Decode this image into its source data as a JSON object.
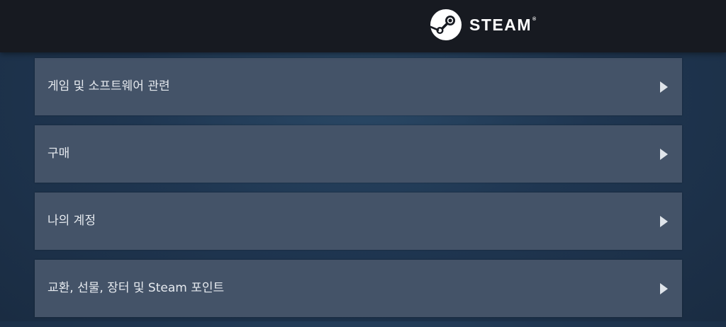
{
  "header": {
    "logo_text": "STEAM",
    "logo_tm": "®",
    "logo_icon": "steam-logo-icon"
  },
  "menu": {
    "items": [
      {
        "label": "게임 및 소프트웨어 관련",
        "icon": "chevron-right-icon"
      },
      {
        "label": "구매",
        "icon": "chevron-right-icon"
      },
      {
        "label": "나의 계정",
        "icon": "chevron-right-icon"
      },
      {
        "label": "교환, 선물, 장터 및 Steam 포인트",
        "icon": "chevron-right-icon"
      }
    ]
  },
  "colors": {
    "header_bg": "#171a21",
    "page_bg": "#1f3651",
    "item_bg": "#445368",
    "text": "#e6eaef"
  }
}
